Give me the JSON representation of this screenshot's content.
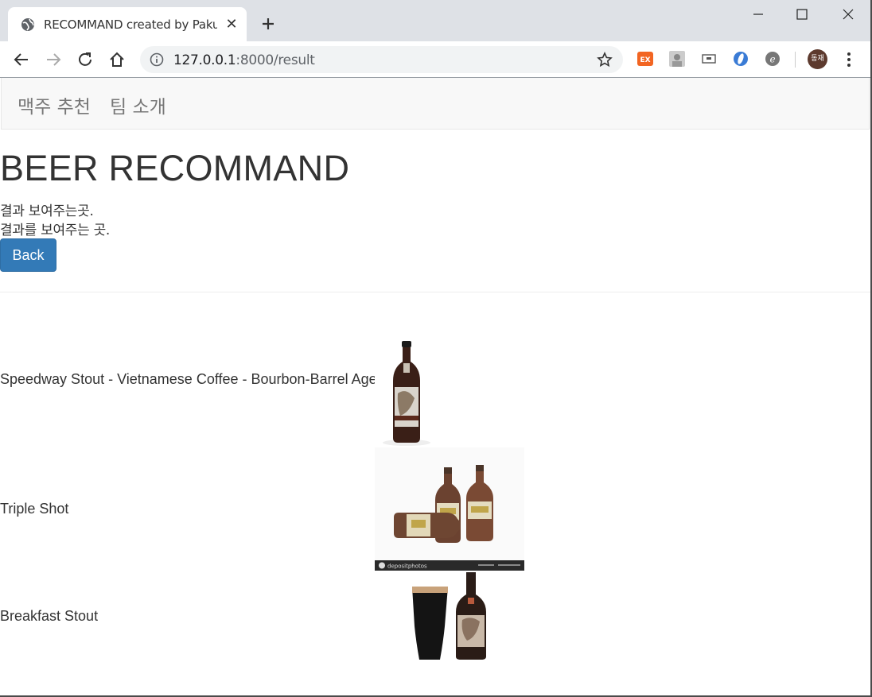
{
  "browser": {
    "tab_title": "RECOMMAND created by Pakup",
    "tab_close": "✕",
    "url_host": "127.0.0.1",
    "url_rest": ":8000/result",
    "profile_label": "동재",
    "extensions": [
      "ex-extension-icon",
      "portrait-extension-icon",
      "cast-extension-icon",
      "ring-extension-icon",
      "e-extension-icon"
    ]
  },
  "navbar": {
    "items": [
      "맥주 추천",
      "팀 소개"
    ]
  },
  "main": {
    "title": "BEER RECOMMAND",
    "line1": "결과 보여주는곳.",
    "line2": "결과를 보여주는 곳.",
    "back_label": "Back"
  },
  "results": [
    {
      "name": "Speedway Stout - Vietnamese Coffee - Bourbon-Barrel Aged",
      "image": "single-dark-bottle-image"
    },
    {
      "name": "Triple Shot",
      "image": "amber-bottles-image",
      "caption": "depositphotos"
    },
    {
      "name": "Breakfast Stout",
      "image": "stout-glass-and-bottle-image"
    }
  ],
  "colors": {
    "primary_button": "#337ab7",
    "navbar_bg": "#f8f8f8",
    "tabstrip_bg": "#dee1e6"
  }
}
